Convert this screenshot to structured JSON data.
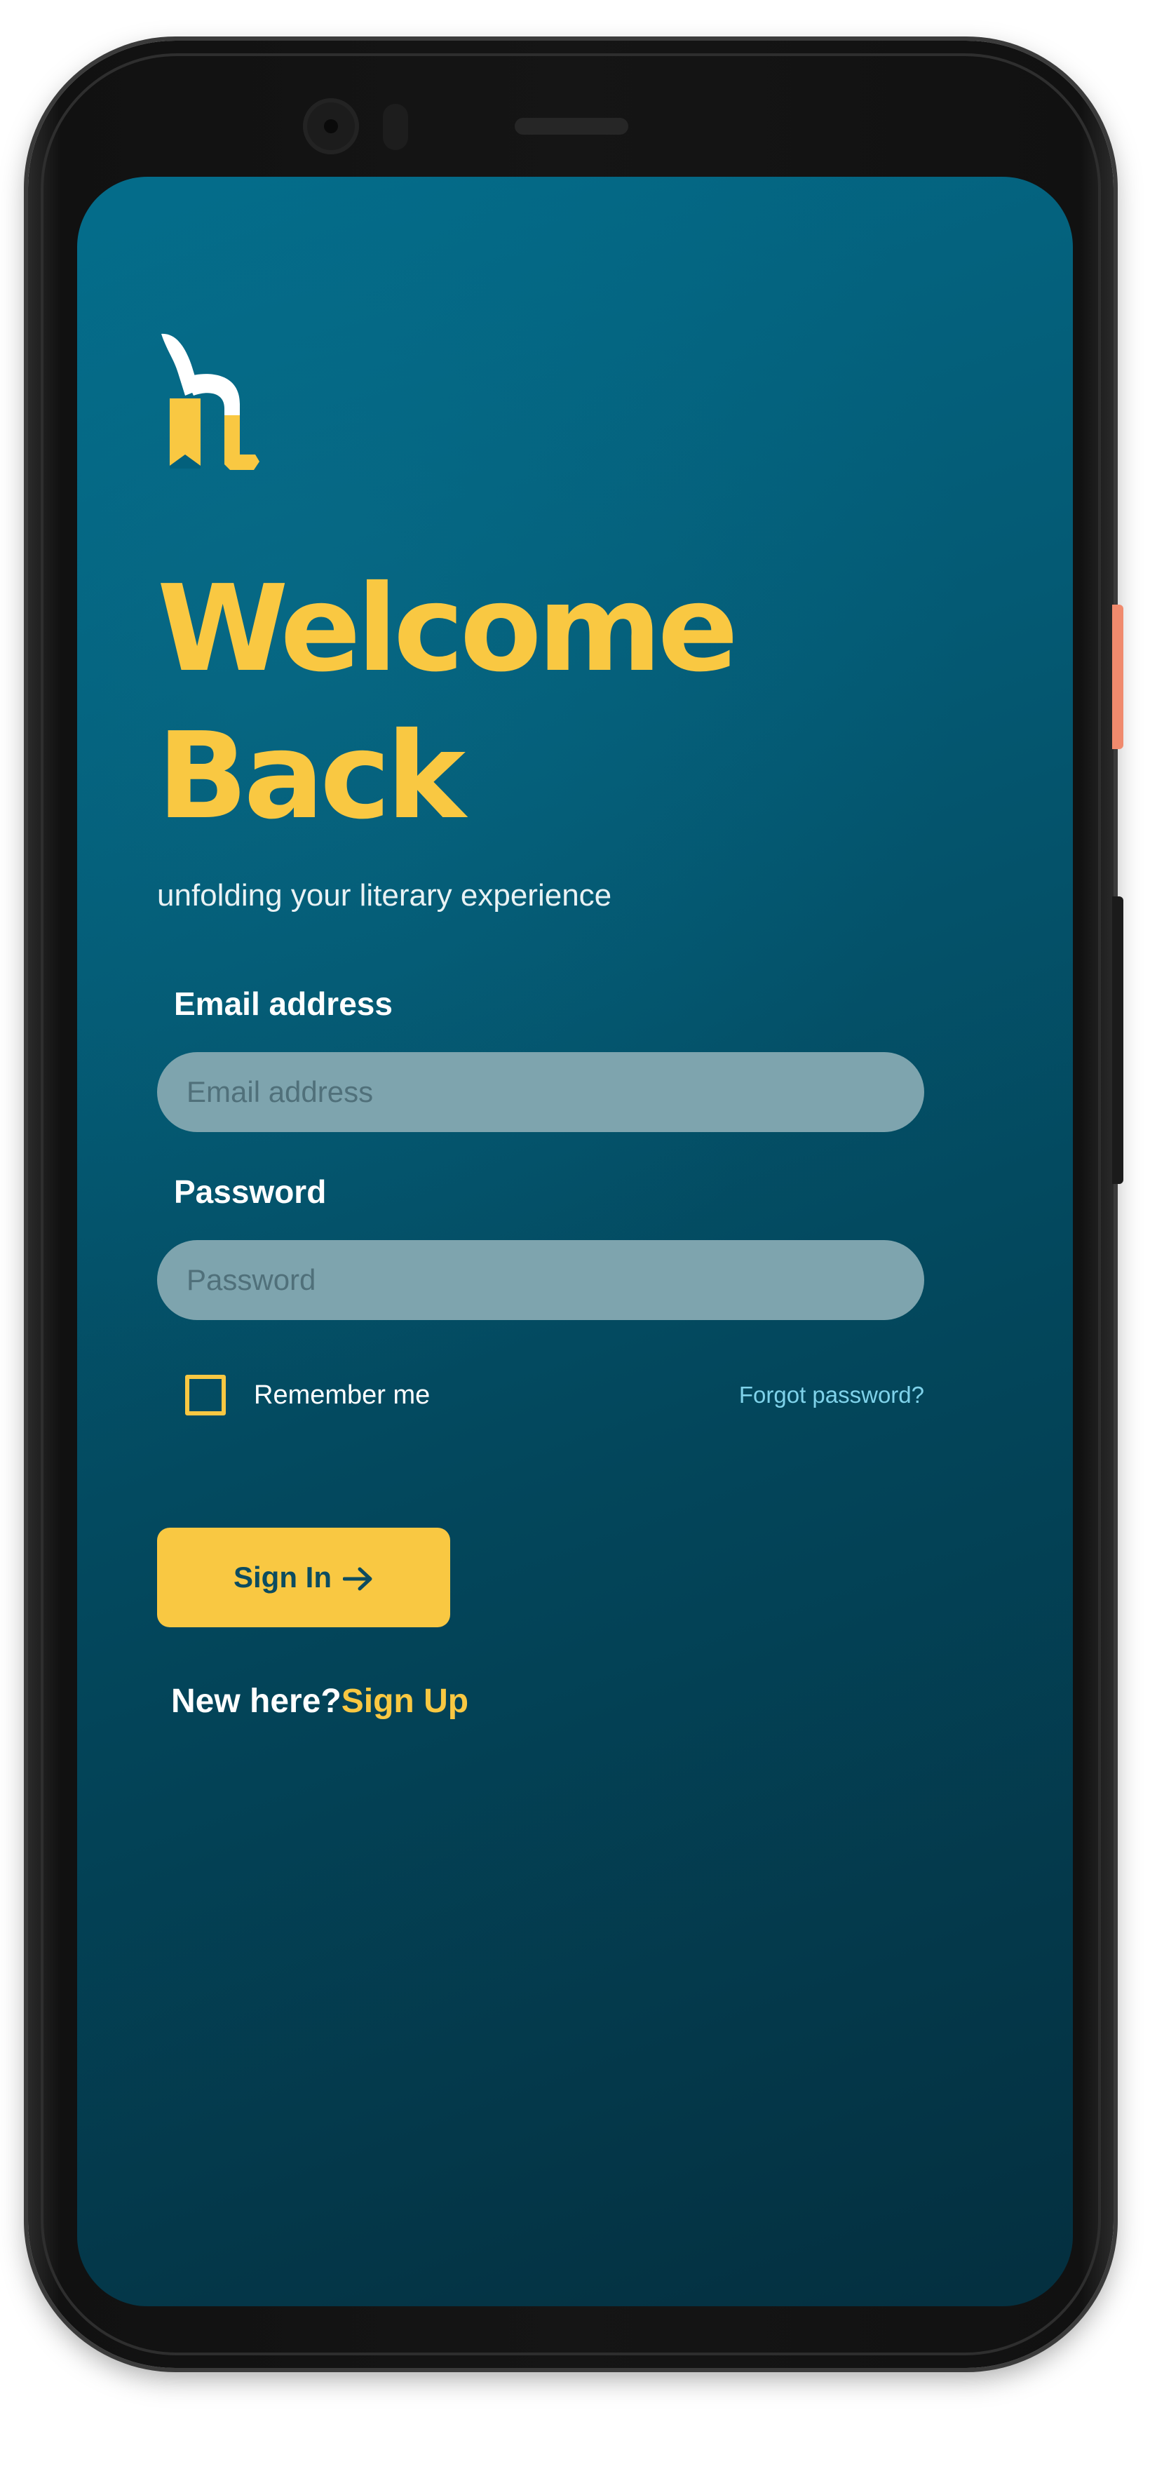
{
  "logo": {
    "icon": "book-h-logo-icon",
    "colors": {
      "primary": "#f9c842",
      "secondary": "#ffffff"
    }
  },
  "heading": {
    "line1": "Welcome",
    "line2": "Back"
  },
  "subtitle": "unfolding your literary experience",
  "form": {
    "email": {
      "label": "Email address",
      "placeholder": "Email address",
      "value": ""
    },
    "password": {
      "label": "Password",
      "placeholder": "Password",
      "value": ""
    },
    "remember_me": {
      "label": "Remember me",
      "checked": false
    },
    "forgot_password": "Forgot password?",
    "submit": {
      "label": "Sign In",
      "icon": "arrow-right-icon"
    }
  },
  "signup": {
    "prompt": "New here?",
    "link": "Sign Up"
  },
  "theme": {
    "accent": "#f9c842",
    "background_top": "#036b89",
    "background_bottom": "#042f3f",
    "input_bg": "#7ea4ae",
    "link": "#7fd2ea"
  }
}
